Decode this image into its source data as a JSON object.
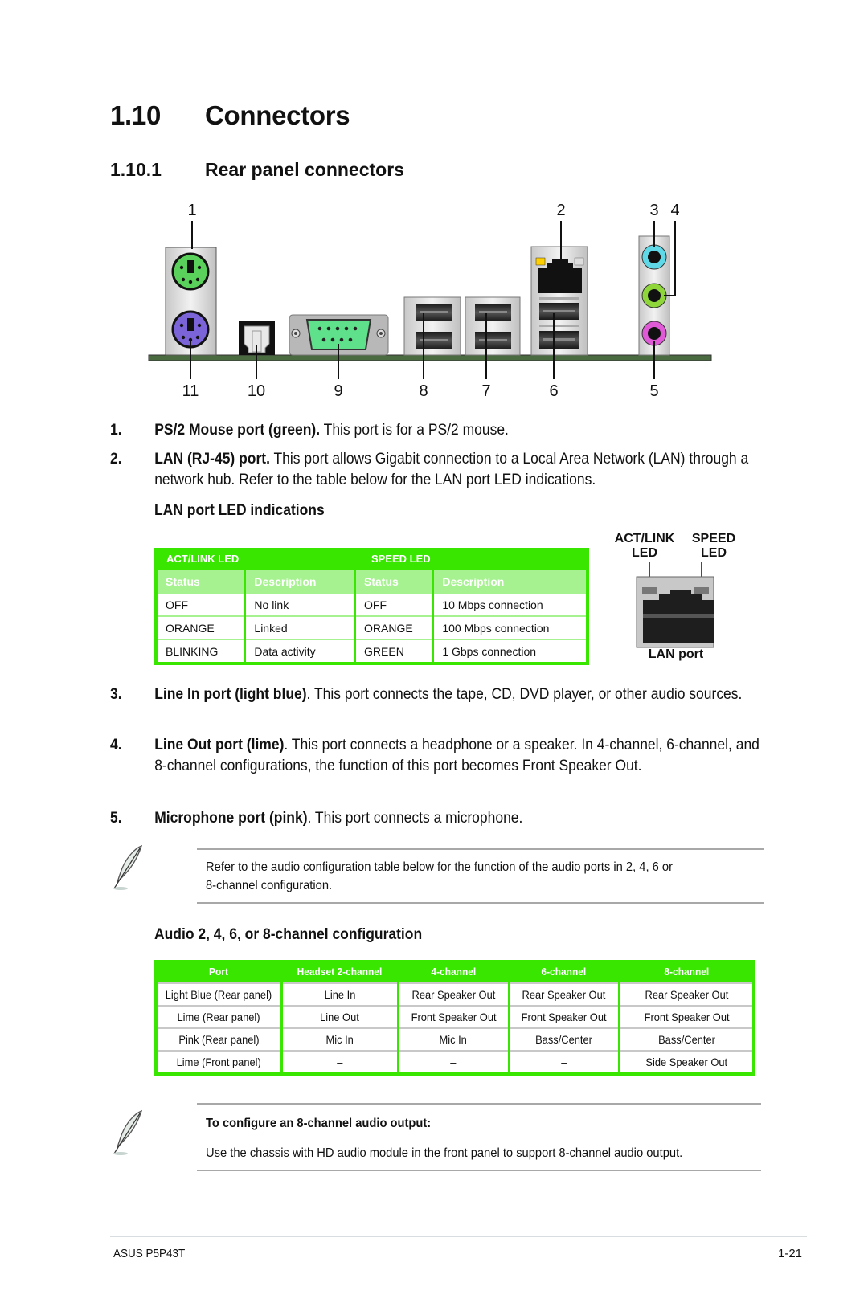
{
  "heading": {
    "number": "1.10",
    "title": "Connectors"
  },
  "subheading": {
    "number": "1.10.1",
    "title": "Rear panel connectors"
  },
  "diagram": {
    "top_labels": [
      "1",
      "2",
      "3",
      "4"
    ],
    "bottom_labels": [
      "11",
      "10",
      "9",
      "8",
      "7",
      "6",
      "5"
    ],
    "port_colors": {
      "ps2_mouse": "#5ad15a",
      "ps2_keyboard": "#7b64d8",
      "serial": "#5fe08a",
      "line_in": "#5fd8e8",
      "line_out": "#8ed63a",
      "mic": "#e05ad8",
      "lan_led_act": "#ffd000",
      "board": "#4a6a40"
    }
  },
  "items": [
    {
      "num": "1.",
      "bold": "PS/2 Mouse port (green).",
      "text": " This port is for a PS/2 mouse."
    },
    {
      "num": "2.",
      "bold": "LAN (RJ-45) port.",
      "text": " This port allows Gigabit connection to a Local Area Network (LAN) through a network hub. Refer to the table below for the LAN port LED indications."
    },
    {
      "num": "3.",
      "bold": "Line In port (light blue)",
      "text": ". This port connects the tape, CD, DVD player, or other audio sources."
    },
    {
      "num": "4.",
      "bold": "Line Out port (lime)",
      "text": ". This port connects a headphone or a speaker. In 4-channel, 6-channel, and 8-channel configurations, the function of this port becomes Front Speaker Out."
    },
    {
      "num": "5.",
      "bold": "Microphone port (pink)",
      "text": ". This port connects a microphone."
    }
  ],
  "lan_led": {
    "heading": "LAN port LED indications",
    "groups": [
      "ACT/LINK LED",
      "SPEED LED"
    ],
    "columns": [
      "Status",
      "Description",
      "Status",
      "Description"
    ],
    "rows": [
      [
        "OFF",
        "No link",
        "OFF",
        "10 Mbps connection"
      ],
      [
        "ORANGE",
        "Linked",
        "ORANGE",
        "100 Mbps connection"
      ],
      [
        "BLINKING",
        "Data activity",
        "GREEN",
        "1 Gbps connection"
      ]
    ],
    "port_labels": {
      "act_link": "ACT/LINK",
      "act_link_led": "LED",
      "speed": "SPEED",
      "speed_led": "LED",
      "caption": "LAN port"
    }
  },
  "note1": {
    "line1": "Refer to the audio configuration table below for the function of the audio ports in 2, 4, 6 or",
    "line2": "8-channel configuration."
  },
  "audio": {
    "heading": "Audio 2, 4, 6, or 8-channel configuration",
    "columns": [
      "Port",
      "Headset 2-channel",
      "4-channel",
      "6-channel",
      "8-channel"
    ],
    "rows": [
      [
        "Light Blue (Rear panel)",
        "Line In",
        "Rear Speaker Out",
        "Rear Speaker Out",
        "Rear Speaker Out"
      ],
      [
        "Lime (Rear panel)",
        "Line Out",
        "Front Speaker Out",
        "Front Speaker Out",
        "Front Speaker Out"
      ],
      [
        "Pink (Rear panel)",
        "Mic In",
        "Mic In",
        "Bass/Center",
        "Bass/Center"
      ],
      [
        "Lime (Front panel)",
        "–",
        "–",
        "–",
        "Side Speaker Out"
      ]
    ]
  },
  "note2": {
    "title": "To configure an 8-channel audio output:",
    "text": "Use the chassis with HD audio module in the front panel to support 8-channel audio output."
  },
  "footer": {
    "left": "ASUS P5P43T",
    "right": "1-21"
  },
  "colors": {
    "table_green": "#39e600",
    "subheader_green": "#a6f290"
  }
}
